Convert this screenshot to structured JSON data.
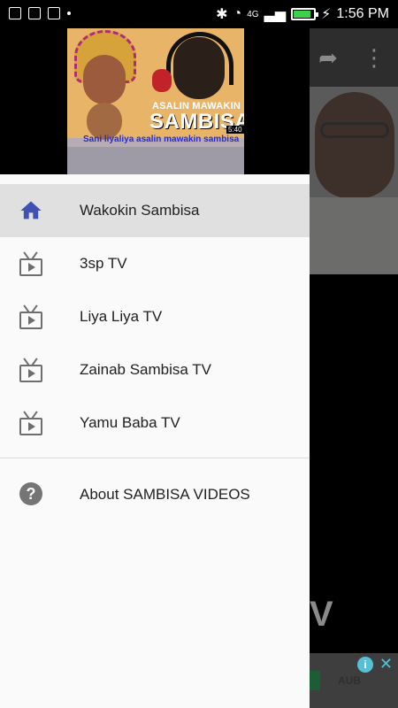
{
  "status_bar": {
    "time": "1:56 PM",
    "network": "4G",
    "icons": [
      "gallery-icon",
      "message-icon",
      "apps-icon",
      "dot-icon",
      "bluetooth-icon",
      "wifi-icon",
      "signal-icon",
      "battery-icon",
      "charging-icon"
    ],
    "battery_level": 0.85,
    "battery_color": "#3bd14b"
  },
  "drawer": {
    "header": {
      "thumbnail_title_small": "ASALIN MAWAKIN",
      "thumbnail_title_big": "SAMBISA",
      "thumbnail_caption": "Sani liyaliya asalin mawakin sambisa",
      "thumbnail_duration": "5:40"
    },
    "items": [
      {
        "label": "Wakokin Sambisa",
        "icon": "home-icon",
        "active": true
      },
      {
        "label": "3sp TV",
        "icon": "tv-icon",
        "active": false
      },
      {
        "label": "Liya Liya TV",
        "icon": "tv-icon",
        "active": false
      },
      {
        "label": "Zainab Sambisa TV",
        "icon": "tv-icon",
        "active": false
      },
      {
        "label": "Yamu Baba TV",
        "icon": "tv-icon",
        "active": false
      }
    ],
    "about": {
      "label": "About SAMBISA VIDEOS",
      "icon": "help-icon"
    },
    "accent_color": "#3f51b5"
  },
  "background_app": {
    "toolbar_icons": [
      "share-icon",
      "more-vert-icon"
    ],
    "partial_text": "V",
    "ad_banner": {
      "info_icon": "info-icon",
      "close_icon": "close-icon",
      "logo_text": "AUB"
    }
  }
}
